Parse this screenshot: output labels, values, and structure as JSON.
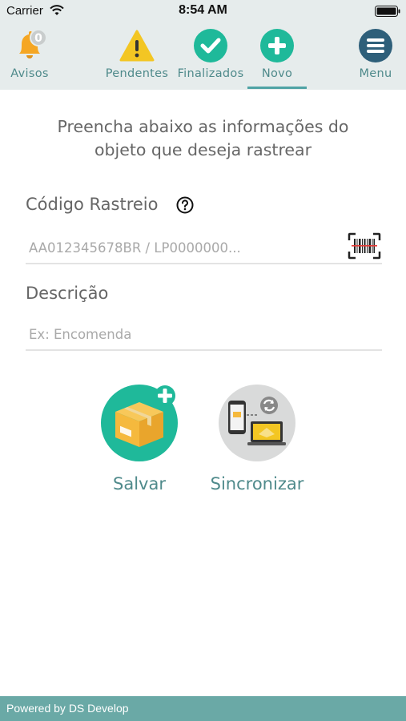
{
  "status_bar": {
    "carrier": "Carrier",
    "time": "8:54 AM"
  },
  "nav": {
    "items": [
      {
        "id": "avisos",
        "label": "Avisos",
        "icon": "bell-icon",
        "badge": "0"
      },
      {
        "id": "pendentes",
        "label": "Pendentes",
        "icon": "warning-icon"
      },
      {
        "id": "finalizados",
        "label": "Finalizados",
        "icon": "check-circle-icon"
      },
      {
        "id": "novo",
        "label": "Novo",
        "icon": "plus-circle-icon",
        "active": true
      },
      {
        "id": "menu",
        "label": "Menu",
        "icon": "hamburger-menu-icon"
      }
    ]
  },
  "form": {
    "intro_line1": "Preencha abaixo as informações do",
    "intro_line2": "objeto que deseja rastrear",
    "tracking_label": "Código Rastreio",
    "tracking_placeholder": "AA012345678BR / LP0000000...",
    "description_label": "Descrição",
    "description_placeholder": "Ex: Encomenda"
  },
  "actions": {
    "save_label": "Salvar",
    "sync_label": "Sincronizar"
  },
  "footer": {
    "text": "Powered by DS Develop"
  },
  "colors": {
    "accent": "#4f8a8b",
    "teal_button": "#1fb99a",
    "nav_background": "#e6ecec",
    "footer": "#6aa9a6",
    "warning": "#f3c623"
  }
}
